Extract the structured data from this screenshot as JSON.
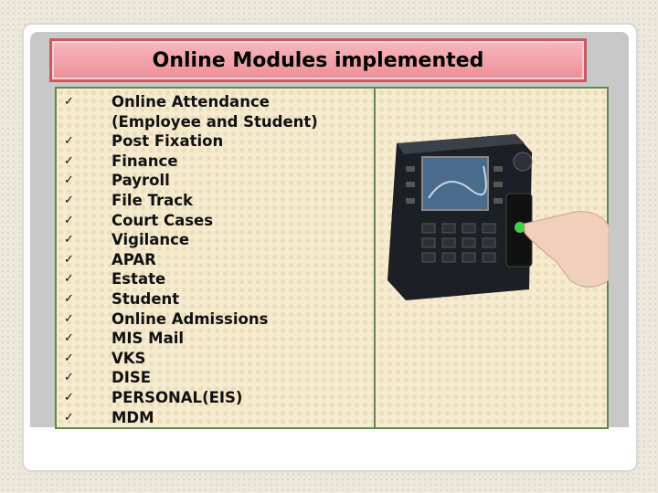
{
  "title": "Online Modules implemented",
  "check_icon": "checkmark-icon",
  "modules": [
    {
      "check": true,
      "label": "Online Attendance"
    },
    {
      "check": false,
      "label": "(Employee and Student)"
    },
    {
      "check": true,
      "label": "Post Fixation"
    },
    {
      "check": true,
      "label": "Finance"
    },
    {
      "check": true,
      "label": "Payroll"
    },
    {
      "check": true,
      "label": "File Track"
    },
    {
      "check": true,
      "label": "Court Cases"
    },
    {
      "check": true,
      "label": "Vigilance"
    },
    {
      "check": true,
      "label": "APAR"
    },
    {
      "check": true,
      "label": "Estate"
    },
    {
      "check": true,
      "label": "Student"
    },
    {
      "check": true,
      "label": "Online Admissions"
    },
    {
      "check": true,
      "label": "MIS Mail"
    },
    {
      "check": true,
      "label": "VKS"
    },
    {
      "check": true,
      "label": "DISE"
    },
    {
      "check": true,
      "label": "PERSONAL(EIS)"
    },
    {
      "check": true,
      "label": "MDM"
    }
  ],
  "colors": {
    "banner": "#ee8f97",
    "border": "#5f8a4a",
    "panel": "#f6ebcf"
  }
}
